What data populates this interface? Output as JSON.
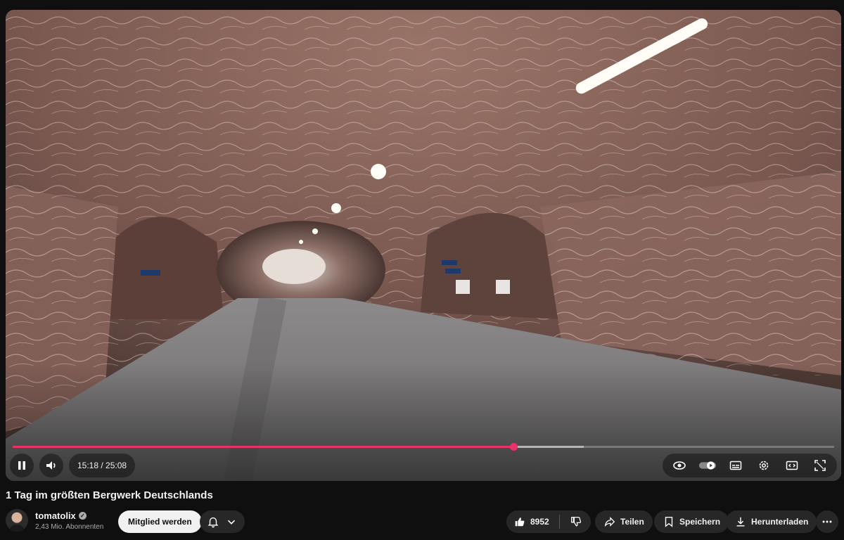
{
  "player": {
    "current_time": "15:18",
    "total_time": "25:08",
    "progress_fraction": 0.61,
    "buffered_fraction": 0.695,
    "accent_color": "#e8326a"
  },
  "video": {
    "title": "1 Tag im größten Bergwerk Deutschlands"
  },
  "channel": {
    "name": "tomatolix",
    "subscribers": "2,43 Mio. Abonnenten",
    "join_label": "Mitglied werden"
  },
  "actions": {
    "like_count": "8952",
    "share_label": "Teilen",
    "save_label": "Speichern",
    "download_label": "Herunterladen"
  },
  "icons": [
    "pause-icon",
    "volume-icon",
    "eye-icon",
    "autoplay-toggle",
    "subtitles-icon",
    "settings-icon",
    "miniplayer-icon",
    "fullscreen-icon",
    "bell-icon",
    "chevron-down-icon",
    "thumbs-up-icon",
    "thumbs-down-icon",
    "share-icon",
    "bookmark-icon",
    "download-icon",
    "more-icon"
  ]
}
